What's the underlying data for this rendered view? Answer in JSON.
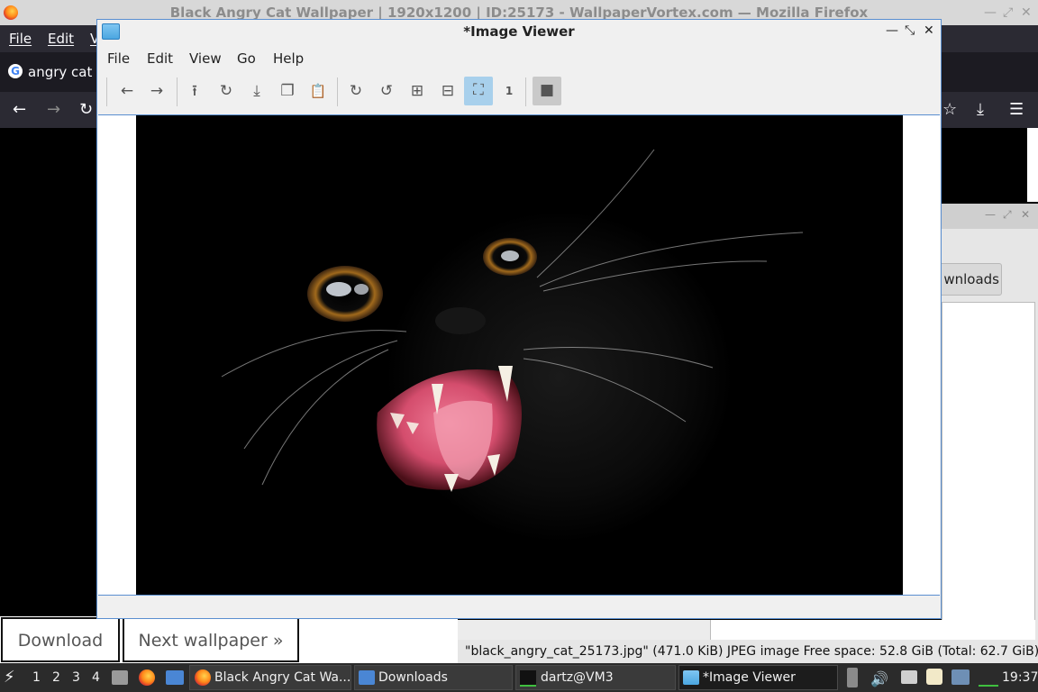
{
  "firefox": {
    "window_title": "Black Angry Cat Wallpaper | 1920x1200 | ID:25173 - WallpaperVortex.com — Mozilla Firefox",
    "menu": [
      "File",
      "Edit",
      "V"
    ],
    "tab_label": "angry cat d",
    "page_buttons": {
      "download": "Download",
      "next": "Next wallpaper »"
    }
  },
  "file_manager": {
    "downloads_button": "wnloads",
    "status_text": "\"black_angry_cat_25173.jpg\" (471.0 KiB) JPEG image   Free space: 52.8 GiB (Total: 62.7 GiB)"
  },
  "image_viewer": {
    "title": "*Image Viewer",
    "menu": [
      "File",
      "Edit",
      "View",
      "Go",
      "Help"
    ],
    "toolbar": [
      {
        "name": "back-icon",
        "glyph": "←"
      },
      {
        "name": "forward-icon",
        "glyph": "→"
      },
      {
        "name": "open-icon",
        "glyph": "⭱"
      },
      {
        "name": "reload-icon",
        "glyph": "↻"
      },
      {
        "name": "save-icon",
        "glyph": "⤓"
      },
      {
        "name": "copy-icon",
        "glyph": "❐"
      },
      {
        "name": "paste-icon",
        "glyph": "📋"
      },
      {
        "name": "rotate-clockwise-icon",
        "glyph": "↻"
      },
      {
        "name": "rotate-counterclockwise-icon",
        "glyph": "↺"
      },
      {
        "name": "zoom-in-icon",
        "glyph": "⊞"
      },
      {
        "name": "zoom-out-icon",
        "glyph": "⊟"
      },
      {
        "name": "fit-window-icon",
        "glyph": "⛶"
      },
      {
        "name": "original-size-icon",
        "glyph": "1"
      },
      {
        "name": "fullscreen-icon",
        "glyph": "■"
      }
    ]
  },
  "taskbar": {
    "workspaces": [
      "1",
      "2",
      "3",
      "4"
    ],
    "tasks": [
      "Black Angry Cat Wa...",
      "Downloads",
      "dartz@VM3",
      "*Image Viewer"
    ],
    "clock": "19:37"
  }
}
